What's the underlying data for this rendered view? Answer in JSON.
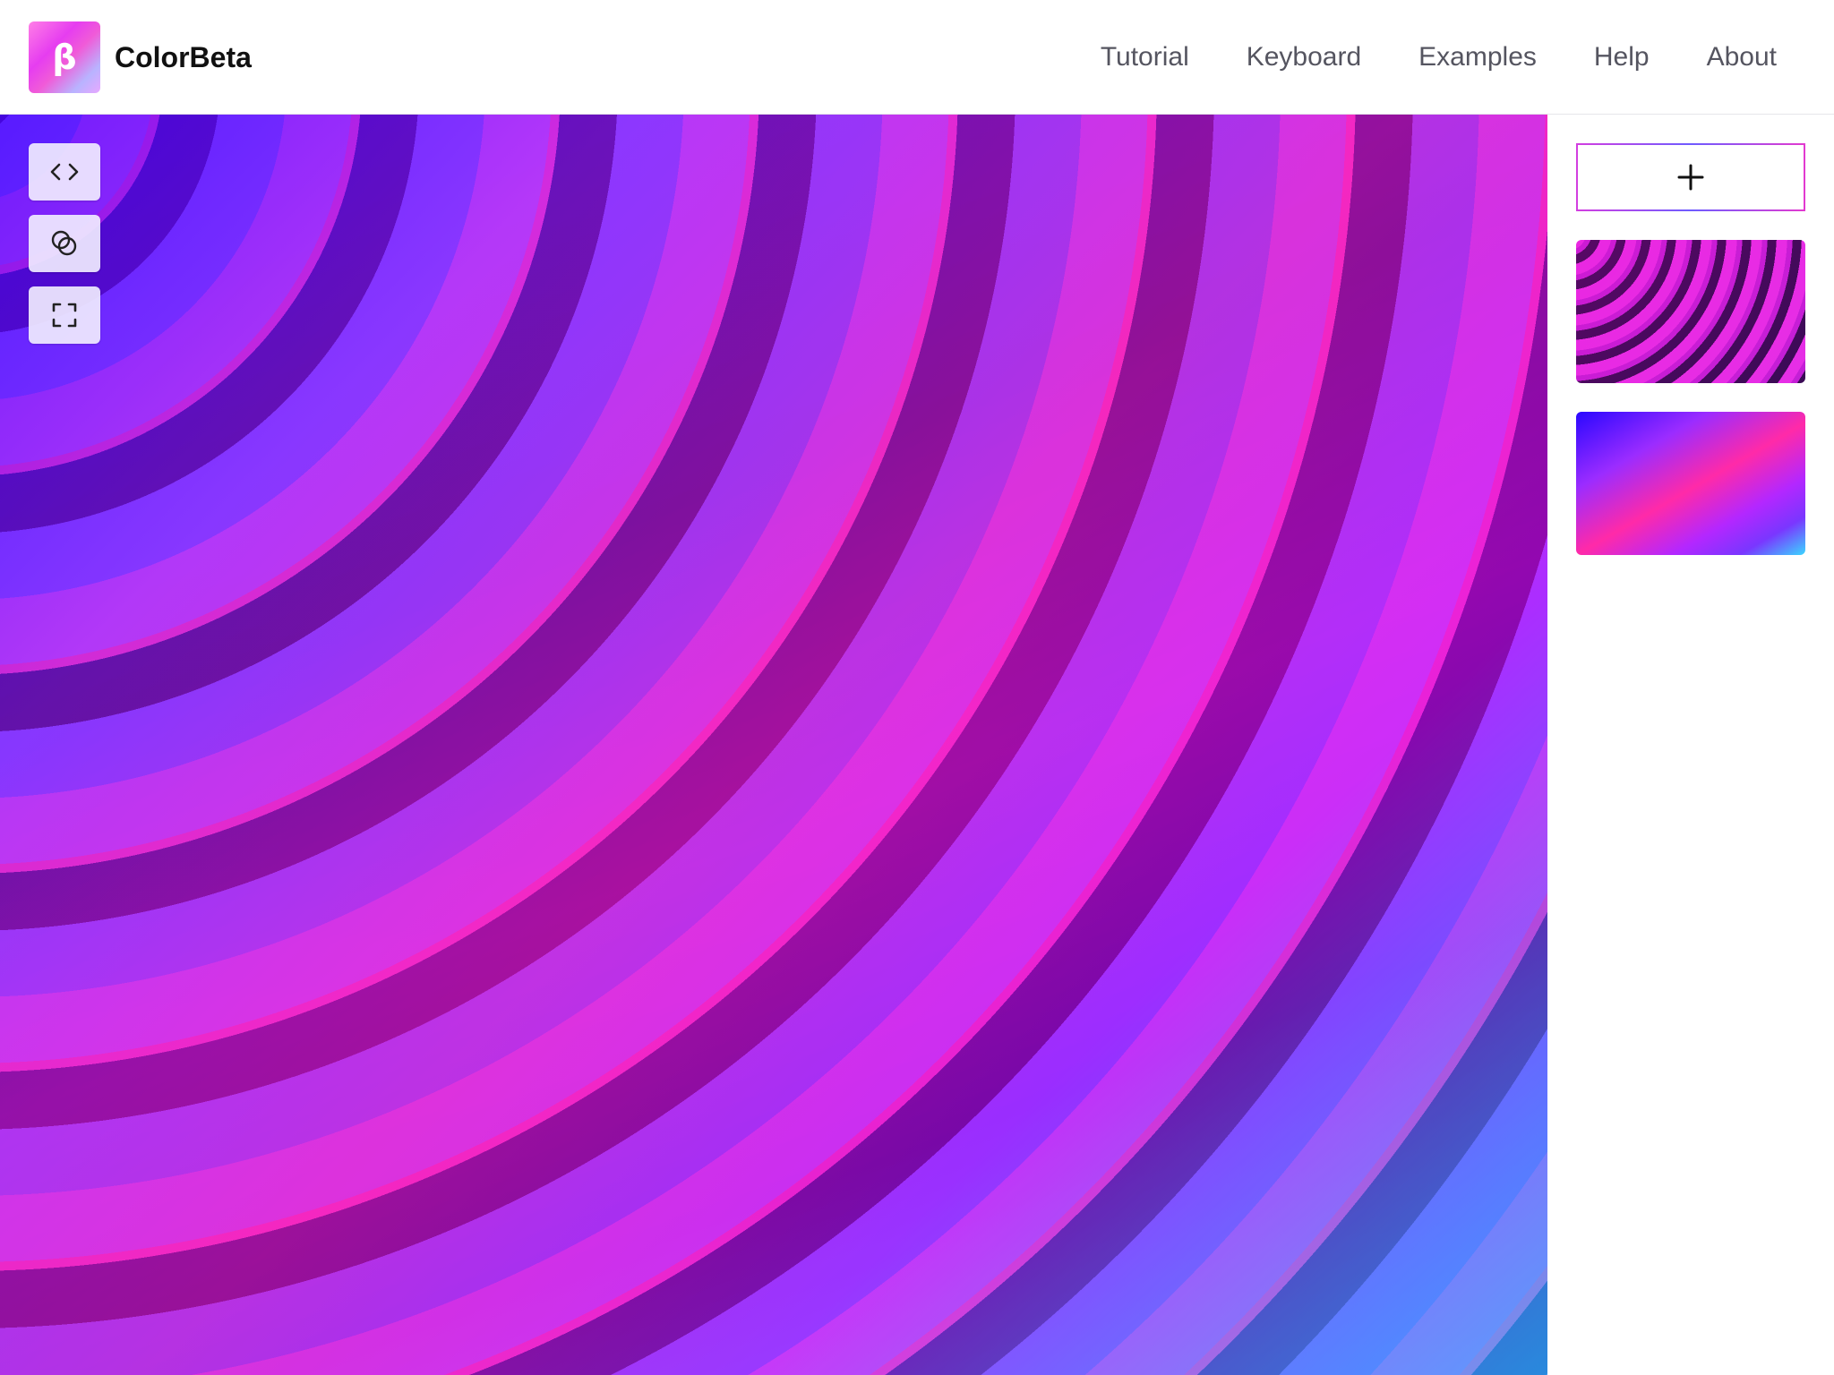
{
  "app": {
    "logo_glyph": "β",
    "brand_name": "ColorBeta"
  },
  "nav": {
    "items": [
      {
        "label": "Tutorial"
      },
      {
        "label": "Keyboard"
      },
      {
        "label": "Examples"
      },
      {
        "label": "Help"
      },
      {
        "label": "About"
      }
    ]
  },
  "toolbar": {
    "buttons": [
      {
        "icon": "code-icon"
      },
      {
        "icon": "blend-circles-icon"
      },
      {
        "icon": "fullscreen-icon"
      }
    ]
  },
  "sidebar": {
    "add_icon": "plus-icon",
    "thumbnails": [
      {
        "name": "concentric-rings-pattern"
      },
      {
        "name": "diagonal-gradient-pattern"
      }
    ]
  },
  "colors": {
    "accent": "#c23ed8",
    "text": "#111111",
    "nav_text": "#555560"
  }
}
